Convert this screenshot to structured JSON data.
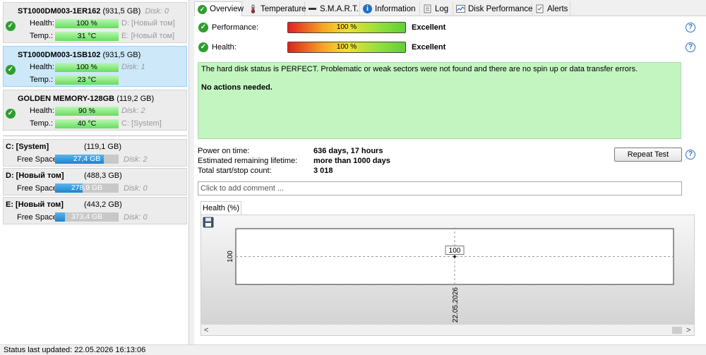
{
  "disks": [
    {
      "name": "ST1000DM003-1ER162",
      "size": "(931,5 GB)",
      "disk_label": "Disk: 0",
      "selected": false,
      "health_label": "Health:",
      "health": "100 %",
      "temp_label": "Temp.:",
      "temp": "31 °C",
      "vol1": "D: [Новый том]",
      "vol2": "E: [Новый том]"
    },
    {
      "name": "ST1000DM003-1SB102",
      "size": "(931,5 GB)",
      "disk_label": "",
      "selected": true,
      "health_label": "Health:",
      "health": "100 %",
      "temp_label": "Temp.:",
      "temp": "23 °C",
      "vol1": "Disk: 1",
      "vol2": ""
    },
    {
      "name": "GOLDEN MEMORY-128GB",
      "size": "(119,2 GB)",
      "disk_label": "",
      "selected": false,
      "health_label": "Health:",
      "health": "90 %",
      "temp_label": "Temp.:",
      "temp": "40 °C",
      "vol1": "Disk: 2",
      "vol2": "C: [System]"
    }
  ],
  "partitions": [
    {
      "name": "C: [System]",
      "size": "(119,1 GB)",
      "free_label": "Free Space",
      "free": "27,4 GB",
      "free_fraction": 0.77,
      "disk": "Disk: 2"
    },
    {
      "name": "D: [Новый том]",
      "size": "(488,3 GB)",
      "free_label": "Free Space",
      "free": "278,9 GB",
      "free_fraction": 0.43,
      "disk": "Disk: 0"
    },
    {
      "name": "E: [Новый том]",
      "size": "(443,2 GB)",
      "free_label": "Free Space",
      "free": "373,4 GB",
      "free_fraction": 0.16,
      "disk": "Disk: 0"
    }
  ],
  "tabs": [
    {
      "label": "Overview",
      "icon": "check-icon",
      "active": true
    },
    {
      "label": "Temperature",
      "icon": "thermometer-icon",
      "active": false
    },
    {
      "label": "S.M.A.R.T.",
      "icon": "smart-icon",
      "active": false
    },
    {
      "label": "Information",
      "icon": "info-icon",
      "active": false
    },
    {
      "label": "Log",
      "icon": "log-icon",
      "active": false
    },
    {
      "label": "Disk Performance",
      "icon": "performance-chart-icon",
      "active": false
    },
    {
      "label": "Alerts",
      "icon": "alerts-icon",
      "active": false
    }
  ],
  "overview": {
    "performance_label": "Performance:",
    "performance_value": "100 %",
    "performance_rating": "Excellent",
    "health_label": "Health:",
    "health_value": "100 %",
    "health_rating": "Excellent",
    "status_line1": "The hard disk status is PERFECT. Problematic or weak sectors were not found and there are no spin up or data transfer errors.",
    "status_line2": "No actions needed.",
    "power_on_label": "Power on time:",
    "power_on_value": "636 days, 17 hours",
    "lifetime_label": "Estimated remaining lifetime:",
    "lifetime_value": "more than 1000 days",
    "startstop_label": "Total start/stop count:",
    "startstop_value": "3 018",
    "repeat_button": "Repeat Test",
    "comment_placeholder": "Click to add comment ...",
    "help": "?"
  },
  "chart_tab": "Health (%)",
  "chart_data": {
    "type": "line",
    "title": "",
    "xlabel": "",
    "ylabel": "",
    "x": [
      "22.05.2026"
    ],
    "series": [
      {
        "values": [
          100
        ]
      }
    ],
    "y_tick": "100",
    "data_label": "100",
    "colors": {
      "line": "#000000",
      "grid": "#999999"
    }
  },
  "statusbar": "Status last updated: 22.05.2026 16:13:06",
  "colors": {
    "health_bar_green": "#66dd5e",
    "selected_bg": "#cce8f9",
    "status_green": "#c3f5c0",
    "free_blue": "#1c84cc",
    "check_green": "#2e9e2e"
  }
}
